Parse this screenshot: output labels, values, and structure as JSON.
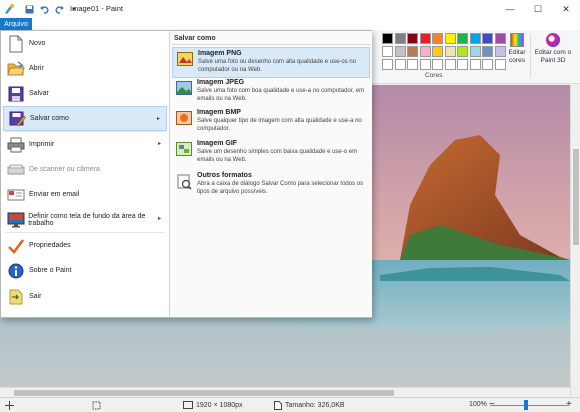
{
  "window": {
    "title": "Image01 - Paint",
    "minimize_label": "—",
    "maximize_label": "☐",
    "close_label": "✕"
  },
  "ribbon": {
    "file_tab": "Arquivo",
    "colors_label": "Cores",
    "edit_colors_label": "Editar cores",
    "edit_paint3d_label": "Editar com o Paint 3D",
    "palette_row1": [
      "#000000",
      "#7f7f7f",
      "#880015",
      "#ed1c24",
      "#ff7f27",
      "#fff200",
      "#22b14c",
      "#00a2e8",
      "#3f48cc",
      "#a349a4"
    ],
    "palette_row2": [
      "#ffffff",
      "#c3c3c3",
      "#b97a57",
      "#ffaec9",
      "#ffc90e",
      "#efe4b0",
      "#b5e61d",
      "#99d9ea",
      "#7092be",
      "#c8bfe7"
    ],
    "palette_row3": [
      "#ffffff",
      "#ffffff",
      "#ffffff",
      "#ffffff",
      "#ffffff",
      "#ffffff",
      "#ffffff",
      "#ffffff",
      "#ffffff",
      "#ffffff"
    ]
  },
  "file_menu": {
    "items": [
      {
        "label": "Novo",
        "icon": "new-file-icon",
        "has_submenu": false,
        "disabled": false
      },
      {
        "label": "Abrir",
        "icon": "open-folder-icon",
        "has_submenu": false,
        "disabled": false
      },
      {
        "label": "Salvar",
        "icon": "save-disk-icon",
        "has_submenu": false,
        "disabled": false
      },
      {
        "label": "Salvar como",
        "icon": "save-as-icon",
        "has_submenu": true,
        "disabled": false
      },
      {
        "label": "Imprimir",
        "icon": "printer-icon",
        "has_submenu": true,
        "disabled": false
      },
      {
        "label": "De scanner ou câmera",
        "icon": "scanner-icon",
        "has_submenu": false,
        "disabled": true
      },
      {
        "label": "Enviar em email",
        "icon": "email-icon",
        "has_submenu": false,
        "disabled": false
      },
      {
        "label": "Definir como tela de fundo da área de trabalho",
        "icon": "desktop-background-icon",
        "has_submenu": true,
        "disabled": false
      },
      {
        "label": "Propriedades",
        "icon": "checkmark-icon",
        "has_submenu": false,
        "disabled": false
      },
      {
        "label": "Sobre o Paint",
        "icon": "info-icon",
        "has_submenu": false,
        "disabled": false
      },
      {
        "label": "Sair",
        "icon": "exit-icon",
        "has_submenu": false,
        "disabled": false
      }
    ],
    "submenu": {
      "header": "Salvar como",
      "items": [
        {
          "title": "Imagem PNG",
          "desc": "Salve uma foto ou desenho com alta qualidade e use-os no computador ou na Web.",
          "icon": "png-image-icon"
        },
        {
          "title": "Imagem JPEG",
          "desc": "Salve uma foto com boa qualidade e use-a no computador, em emails ou na Web.",
          "icon": "jpeg-image-icon"
        },
        {
          "title": "Imagem BMP",
          "desc": "Salve qualquer tipo de imagem com alta qualidade e use-a no computador.",
          "icon": "bmp-image-icon"
        },
        {
          "title": "Imagem GIF",
          "desc": "Salve um desenho simples com baixa qualidade e use-o em emails ou na Web.",
          "icon": "gif-image-icon"
        },
        {
          "title": "Outros formatos",
          "desc": "Abra a caixa de diálogo Salvar Como para selecionar todos os tipos de arquivo possíveis.",
          "icon": "other-formats-icon"
        }
      ]
    }
  },
  "statusbar": {
    "dimensions": "1920 × 1080px",
    "size": "Tamanho: 326,0KB",
    "zoom": "100%",
    "zoom_minus": "−",
    "zoom_plus": "+"
  }
}
